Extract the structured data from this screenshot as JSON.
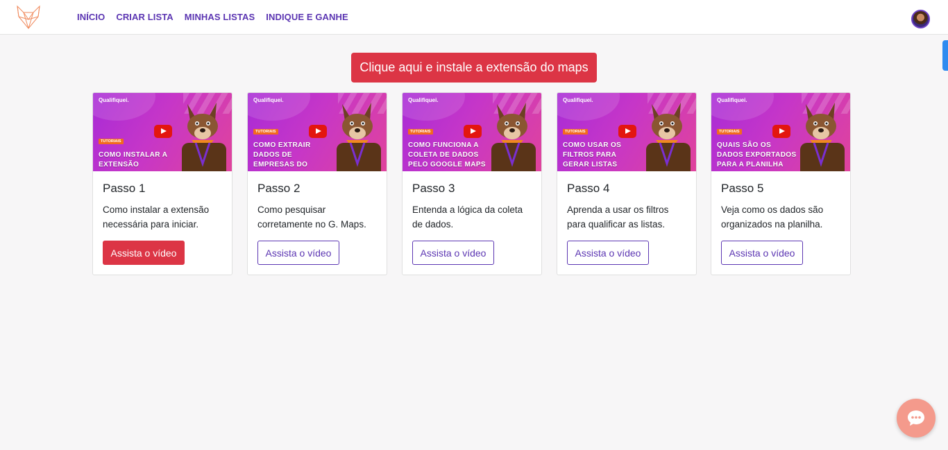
{
  "nav": {
    "links": [
      "INÍCIO",
      "CRIAR LISTA",
      "MINHAS LISTAS",
      "INDIQUE E GANHE"
    ]
  },
  "install_button": "Clique aqui e instale a extensão do maps",
  "cards": [
    {
      "thumb_brand": "Qualifiquei.",
      "thumb_tag": "TUTORIAIS",
      "thumb_title": "COMO INSTALAR A EXTENSÃO QUALIFIQUEI",
      "title": "Passo 1",
      "description": "Como instalar a extensão necessária para iniciar.",
      "button": "Assista o vídeo"
    },
    {
      "thumb_brand": "Qualifiquei.",
      "thumb_tag": "TUTORIAIS",
      "thumb_title": "COMO EXTRAIR DADOS DE EMPRESAS DO GOOGLE MAPS",
      "title": "Passo 2",
      "description": "Como pesquisar corretamente no G. Maps.",
      "button": "Assista o vídeo"
    },
    {
      "thumb_brand": "Qualifiquei.",
      "thumb_tag": "TUTORIAIS",
      "thumb_title": "COMO FUNCIONA A COLETA DE DADOS PELO GOOGLE MAPS",
      "title": "Passo 3",
      "description": "Entenda a lógica da coleta de dados.",
      "button": "Assista o vídeo"
    },
    {
      "thumb_brand": "Qualifiquei.",
      "thumb_tag": "TUTORIAIS",
      "thumb_title": "COMO USAR OS FILTROS PARA GERAR LISTAS QUALIFICADAS",
      "title": "Passo 4",
      "description": "Aprenda a usar os filtros para qualificar as listas.",
      "button": "Assista o vídeo"
    },
    {
      "thumb_brand": "Qualifiquei.",
      "thumb_tag": "TUTORIAIS",
      "thumb_title": "QUAIS SÃO OS DADOS EXPORTADOS PARA A PLANILHA",
      "title": "Passo 5",
      "description": "Veja como os dados são organizados na planilha.",
      "button": "Assista o vídeo"
    }
  ],
  "colors": {
    "primary_red": "#dc3545",
    "brand_purple": "#5b35b2",
    "thumb_gradient_start": "#a82bd6",
    "thumb_gradient_end": "#e0439c",
    "chat_bubble": "#f49a8c"
  },
  "icons": {
    "logo": "fox-logo-icon",
    "play": "youtube-play-icon",
    "chat": "chat-bubble-icon"
  }
}
